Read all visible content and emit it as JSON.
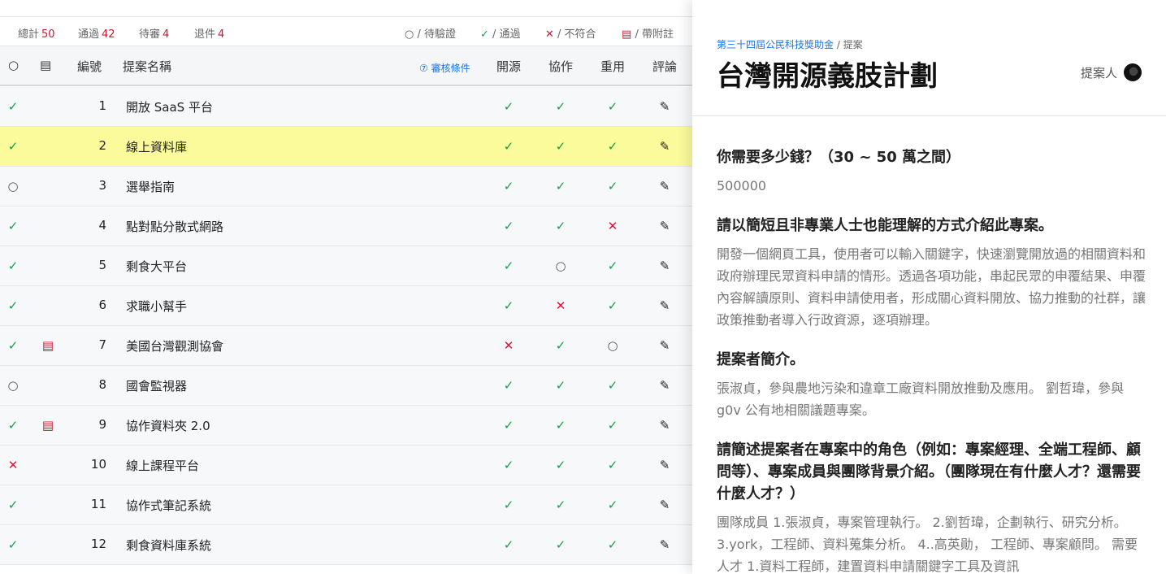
{
  "stats": [
    {
      "label": "總計",
      "value": "50"
    },
    {
      "label": "通過",
      "value": "42"
    },
    {
      "label": "待審",
      "value": "4"
    },
    {
      "label": "退件",
      "value": "4"
    }
  ],
  "legend": [
    {
      "icon": "○",
      "text": "/ 待驗證"
    },
    {
      "icon": "✓",
      "text": "/ 通過"
    },
    {
      "icon": "✕",
      "text": "/ 不符合"
    },
    {
      "icon": "▤",
      "text": "/ 帶附註"
    }
  ],
  "table": {
    "header": {
      "status_icon": "○",
      "note_icon": "▤",
      "number": "編號",
      "name": "提案名稱",
      "criteria_link": "⑦ 審核條件",
      "open_source": "開源",
      "collab": "協作",
      "reuse": "重用",
      "comment": "評論"
    },
    "rows": [
      {
        "status": "ok",
        "note": false,
        "num": "1",
        "name": "開放 SaaS 平台",
        "open": "ok",
        "collab": "ok",
        "reuse": "ok"
      },
      {
        "status": "ok",
        "note": false,
        "num": "2",
        "name": "線上資料庫",
        "open": "ok",
        "collab": "ok",
        "reuse": "ok"
      },
      {
        "status": "pending",
        "note": false,
        "num": "3",
        "name": "選舉指南",
        "open": "ok",
        "collab": "ok",
        "reuse": "ok"
      },
      {
        "status": "ok",
        "note": false,
        "num": "4",
        "name": "點對點分散式網路",
        "open": "ok",
        "collab": "ok",
        "reuse": "bad"
      },
      {
        "status": "ok",
        "note": false,
        "num": "5",
        "name": "剩食大平台",
        "open": "ok",
        "collab": "pending",
        "reuse": "ok"
      },
      {
        "status": "ok",
        "note": false,
        "num": "6",
        "name": "求職小幫手",
        "open": "ok",
        "collab": "bad",
        "reuse": "ok"
      },
      {
        "status": "ok",
        "note": true,
        "num": "7",
        "name": "美國台灣觀測協會",
        "open": "bad",
        "collab": "ok",
        "reuse": "pending"
      },
      {
        "status": "pending",
        "note": false,
        "num": "8",
        "name": "國會監視器",
        "open": "ok",
        "collab": "ok",
        "reuse": "ok"
      },
      {
        "status": "ok",
        "note": true,
        "num": "9",
        "name": "協作資料夾 2.0",
        "open": "ok",
        "collab": "ok",
        "reuse": "ok"
      },
      {
        "status": "bad",
        "note": false,
        "num": "10",
        "name": "線上課程平台",
        "open": "ok",
        "collab": "ok",
        "reuse": "ok"
      },
      {
        "status": "ok",
        "note": false,
        "num": "11",
        "name": "協作式筆記系統",
        "open": "ok",
        "collab": "ok",
        "reuse": "ok"
      },
      {
        "status": "ok",
        "note": false,
        "num": "12",
        "name": "剩食資料庫系統",
        "open": "ok",
        "collab": "ok",
        "reuse": "ok"
      }
    ],
    "highlighted_row": "2"
  },
  "detail": {
    "breadcrumb_link": "第三十四屆公民科技獎助金",
    "breadcrumb_rest": "/ 提案",
    "title": "台灣開源義肢計劃",
    "proposer_label": "提案人",
    "sections": [
      {
        "q": "你需要多少錢？（30 ~ 50 萬之間）",
        "a": "500000"
      },
      {
        "q": "請以簡短且非專業人士也能理解的方式介紹此專案。",
        "a": "開發一個網頁工具，使用者可以輸入關鍵字，快速瀏覽開放過的相關資料和政府辦理民眾資料申請的情形。透過各項功能，串起民眾的申覆結果、申覆內容解讀原則、資料申請使用者，形成關心資料開放、協力推動的社群，讓政策推動者導入行政資源，逐項辦理。"
      },
      {
        "q": "提案者簡介。",
        "a": "張淑貞，參與農地污染和違章工廠資料開放推動及應用。 劉哲瑋，參與 g0v 公有地相關議題專案。"
      },
      {
        "q": "請簡述提案者在專案中的角色（例如：專案經理、全端工程師、顧問等）、專案成員與團隊背景介紹。（團隊現在有什麼人才？還需要什麼人才？）",
        "a": "團隊成員 1.張淑貞，專案管理執行。 2.劉哲瑋，企劃執行、研究分析。 3.york，工程師、資料蒐集分析。 4..高英勛， 工程師、專案顧問。 需要人才 1.資料工程師，建置資料申請關鍵字工具及資訊"
      }
    ]
  },
  "colors": {
    "ok": "#13a04a",
    "bad": "#e0123a",
    "accent_link": "#1a73e8",
    "highlight": "#fbfb9c",
    "stat_num": "#d0142f"
  },
  "icons": {
    "ok": "check-icon",
    "bad": "cross-icon",
    "pending": "circle-icon",
    "note": "document-icon",
    "comment": "pencil-icon"
  }
}
